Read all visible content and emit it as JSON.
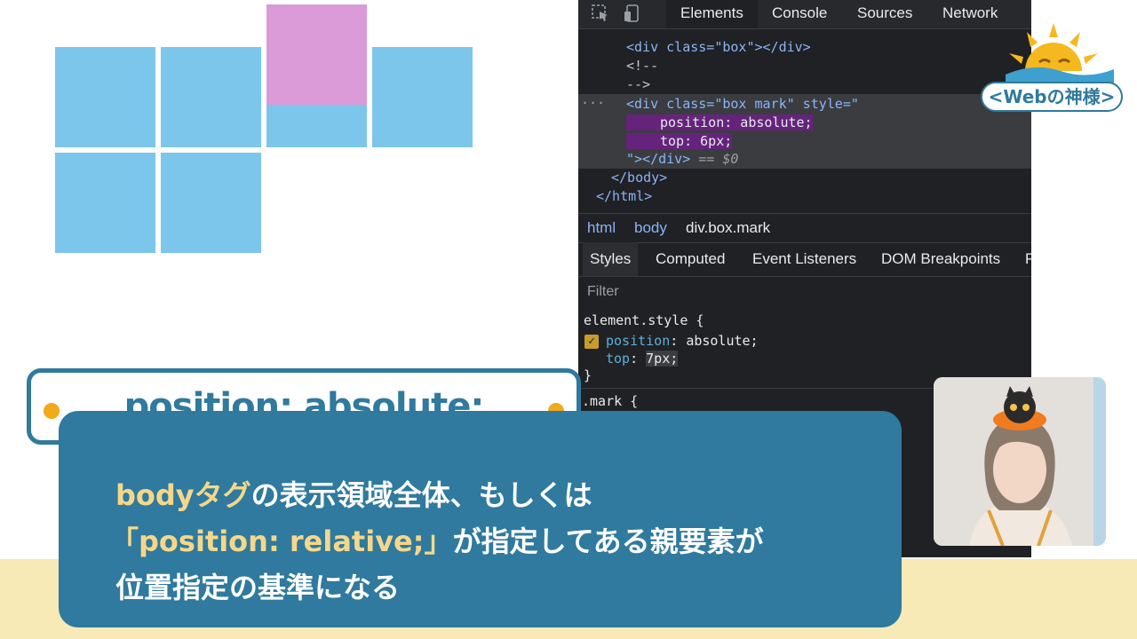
{
  "devtools": {
    "tabs": [
      "Elements",
      "Console",
      "Sources",
      "Network"
    ],
    "code_lines": {
      "box_div": "<div class=\"box\"></div>",
      "comment_open": "<!--",
      "comment_close": "-->",
      "mark_open": "<div class=\"box mark\" style=\"",
      "mark_pos": "position: absolute;",
      "mark_top": "top: 6px;",
      "mark_close": "\"></div>",
      "mark_ref": "== $0",
      "body_close": "</body>",
      "html_close": "</html>",
      "ellipsis": "···"
    },
    "breadcrumbs": [
      "html",
      "body",
      "div.box.mark"
    ],
    "subtabs": [
      "Styles",
      "Computed",
      "Event Listeners",
      "DOM Breakpoints",
      "P"
    ],
    "filter_placeholder": "Filter",
    "styles": {
      "selector": "element.style {",
      "prop1": "position",
      "val1": "absolute;",
      "prop2": "top",
      "val2": "7px;",
      "close": "}",
      "next_rule": ".mark {"
    }
  },
  "title": {
    "text": "position: absolute;"
  },
  "caption": {
    "line1_hl": "bodyタグ",
    "line1_rest": "の表示領域全体、もしくは",
    "line2_hl": "「position: relative;」",
    "line2_rest": "が指定してある親要素が",
    "line3": "位置指定の基準になる"
  },
  "logo": {
    "text": "<Webの神様>"
  },
  "colors": {
    "box": "#7bc6ea",
    "mark": "#da9bd8",
    "accent": "#2f7a9e",
    "highlight": "#f6d78a",
    "cream": "#f7eab6",
    "dot": "#f2a91b"
  },
  "icons": {
    "inspect": "cursor-select-icon",
    "device": "device-toggle-icon",
    "checkbox": "checkmark-icon",
    "logo": "sun-wave-logo-icon"
  }
}
